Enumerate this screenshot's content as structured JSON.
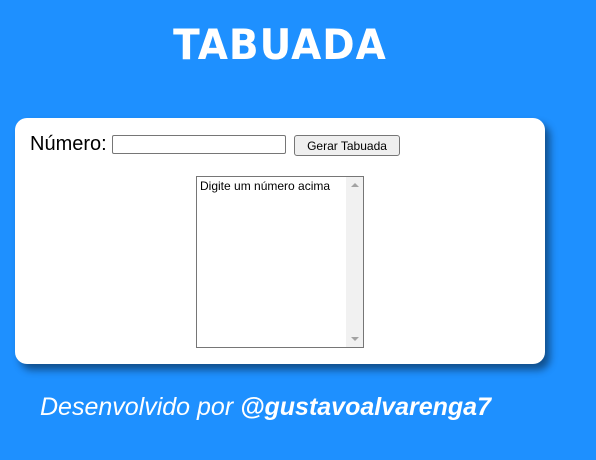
{
  "page": {
    "title": "TABUADA"
  },
  "form": {
    "number_label": "Número:",
    "number_value": "",
    "generate_button": "Gerar Tabuada"
  },
  "result": {
    "options": [
      "Digite um número acima"
    ]
  },
  "footer": {
    "prefix": "Desenvolvido por ",
    "handle": "@gustavoalvarenga7"
  },
  "colors": {
    "background": "#1e90ff",
    "card": "#ffffff",
    "text_on_background": "#ffffff"
  }
}
